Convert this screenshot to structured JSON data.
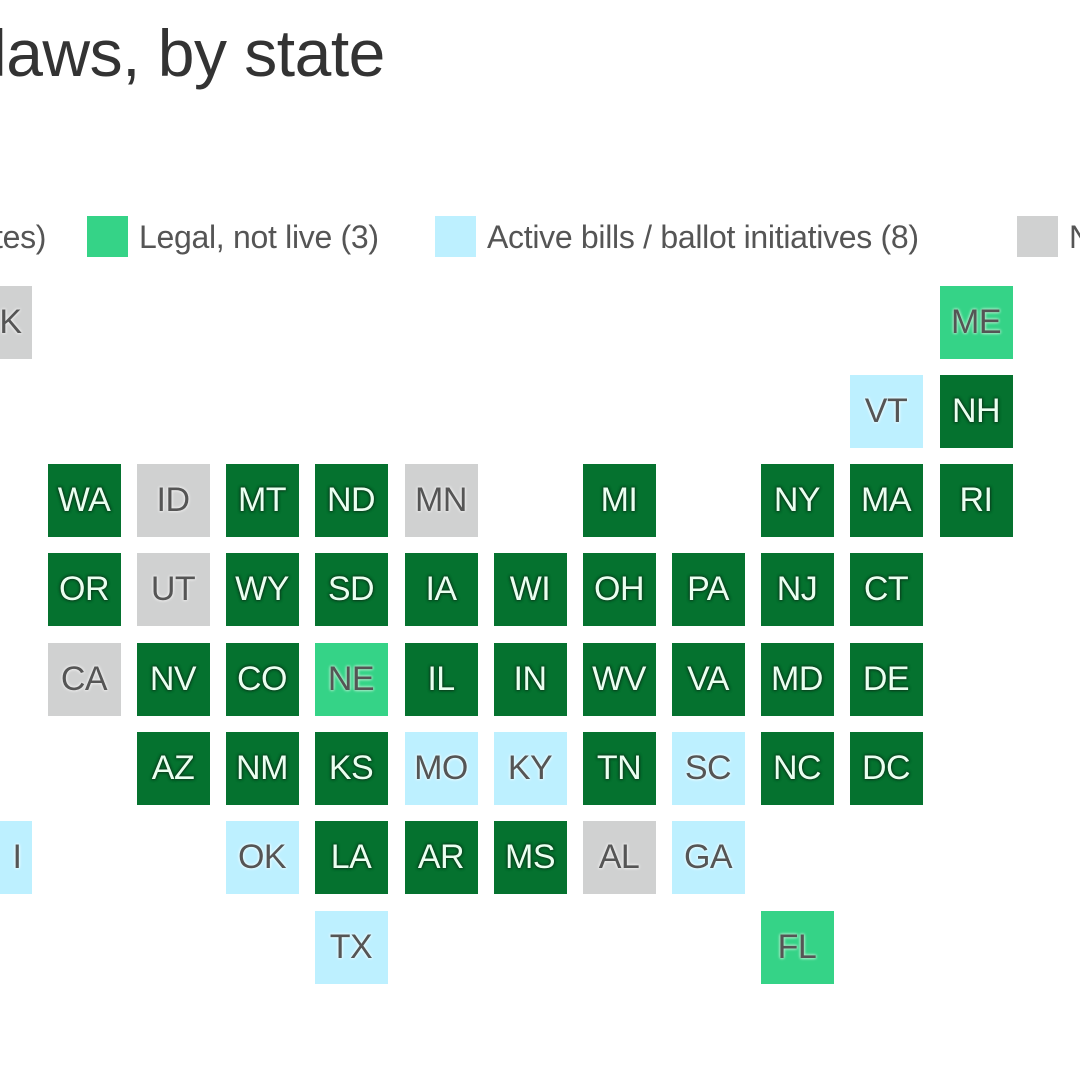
{
  "title": "g laws, by state",
  "legend": [
    {
      "key": "live",
      "label": "tes)",
      "color": "#05722f",
      "swatch": false
    },
    {
      "key": "notlive",
      "label": "Legal, not live (3)",
      "color": "#35d387",
      "swatch": true
    },
    {
      "key": "active",
      "label": "Active bills / ballot initiatives (8)",
      "color": "#bdf0ff",
      "swatch": true
    },
    {
      "key": "none",
      "label": "N",
      "color": "#d0d1d1",
      "swatch": true
    }
  ],
  "chart_data": {
    "type": "tile-map",
    "title": "g laws, by state",
    "categories": {
      "live": {
        "label": "(partially visible) ...tes)",
        "color": "#05722f"
      },
      "notlive": {
        "label": "Legal, not live (3)",
        "color": "#35d387"
      },
      "active": {
        "label": "Active bills/ballot initiatives (8)",
        "color": "#bdf0ff"
      },
      "none": {
        "label": "N... (cut off)",
        "color": "#d0d1d1"
      }
    },
    "states": [
      {
        "abbr": "AK",
        "label": "K",
        "status": "none",
        "col": 0,
        "row": 0
      },
      {
        "abbr": "ME",
        "label": "ME",
        "status": "notlive",
        "col": 11,
        "row": 0
      },
      {
        "abbr": "VT",
        "label": "VT",
        "status": "active",
        "col": 10,
        "row": 1
      },
      {
        "abbr": "NH",
        "label": "NH",
        "status": "live",
        "col": 11,
        "row": 1
      },
      {
        "abbr": "WA",
        "label": "WA",
        "status": "live",
        "col": 1,
        "row": 2
      },
      {
        "abbr": "ID",
        "label": "ID",
        "status": "none",
        "col": 2,
        "row": 2
      },
      {
        "abbr": "MT",
        "label": "MT",
        "status": "live",
        "col": 3,
        "row": 2
      },
      {
        "abbr": "ND",
        "label": "ND",
        "status": "live",
        "col": 4,
        "row": 2
      },
      {
        "abbr": "MN",
        "label": "MN",
        "status": "none",
        "col": 5,
        "row": 2
      },
      {
        "abbr": "MI",
        "label": "MI",
        "status": "live",
        "col": 7,
        "row": 2
      },
      {
        "abbr": "NY",
        "label": "NY",
        "status": "live",
        "col": 9,
        "row": 2
      },
      {
        "abbr": "MA",
        "label": "MA",
        "status": "live",
        "col": 10,
        "row": 2
      },
      {
        "abbr": "RI",
        "label": "RI",
        "status": "live",
        "col": 11,
        "row": 2
      },
      {
        "abbr": "OR",
        "label": "OR",
        "status": "live",
        "col": 1,
        "row": 3
      },
      {
        "abbr": "UT",
        "label": "UT",
        "status": "none",
        "col": 2,
        "row": 3
      },
      {
        "abbr": "WY",
        "label": "WY",
        "status": "live",
        "col": 3,
        "row": 3
      },
      {
        "abbr": "SD",
        "label": "SD",
        "status": "live",
        "col": 4,
        "row": 3
      },
      {
        "abbr": "IA",
        "label": "IA",
        "status": "live",
        "col": 5,
        "row": 3
      },
      {
        "abbr": "WI",
        "label": "WI",
        "status": "live",
        "col": 6,
        "row": 3
      },
      {
        "abbr": "OH",
        "label": "OH",
        "status": "live",
        "col": 7,
        "row": 3
      },
      {
        "abbr": "PA",
        "label": "PA",
        "status": "live",
        "col": 8,
        "row": 3
      },
      {
        "abbr": "NJ",
        "label": "NJ",
        "status": "live",
        "col": 9,
        "row": 3
      },
      {
        "abbr": "CT",
        "label": "CT",
        "status": "live",
        "col": 10,
        "row": 3
      },
      {
        "abbr": "CA",
        "label": "CA",
        "status": "none",
        "col": 1,
        "row": 4
      },
      {
        "abbr": "NV",
        "label": "NV",
        "status": "live",
        "col": 2,
        "row": 4
      },
      {
        "abbr": "CO",
        "label": "CO",
        "status": "live",
        "col": 3,
        "row": 4
      },
      {
        "abbr": "NE",
        "label": "NE",
        "status": "notlive",
        "col": 4,
        "row": 4
      },
      {
        "abbr": "IL",
        "label": "IL",
        "status": "live",
        "col": 5,
        "row": 4
      },
      {
        "abbr": "IN",
        "label": "IN",
        "status": "live",
        "col": 6,
        "row": 4
      },
      {
        "abbr": "WV",
        "label": "WV",
        "status": "live",
        "col": 7,
        "row": 4
      },
      {
        "abbr": "VA",
        "label": "VA",
        "status": "live",
        "col": 8,
        "row": 4
      },
      {
        "abbr": "MD",
        "label": "MD",
        "status": "live",
        "col": 9,
        "row": 4
      },
      {
        "abbr": "DE",
        "label": "DE",
        "status": "live",
        "col": 10,
        "row": 4
      },
      {
        "abbr": "AZ",
        "label": "AZ",
        "status": "live",
        "col": 2,
        "row": 5
      },
      {
        "abbr": "NM",
        "label": "NM",
        "status": "live",
        "col": 3,
        "row": 5
      },
      {
        "abbr": "KS",
        "label": "KS",
        "status": "live",
        "col": 4,
        "row": 5
      },
      {
        "abbr": "MO",
        "label": "MO",
        "status": "active",
        "col": 5,
        "row": 5
      },
      {
        "abbr": "KY",
        "label": "KY",
        "status": "active",
        "col": 6,
        "row": 5
      },
      {
        "abbr": "TN",
        "label": "TN",
        "status": "live",
        "col": 7,
        "row": 5
      },
      {
        "abbr": "SC",
        "label": "SC",
        "status": "active",
        "col": 8,
        "row": 5
      },
      {
        "abbr": "NC",
        "label": "NC",
        "status": "live",
        "col": 9,
        "row": 5
      },
      {
        "abbr": "DC",
        "label": "DC",
        "status": "live",
        "col": 10,
        "row": 5
      },
      {
        "abbr": "HI",
        "label": "I",
        "status": "active",
        "col": 0,
        "row": 6
      },
      {
        "abbr": "OK",
        "label": "OK",
        "status": "active",
        "col": 3,
        "row": 6
      },
      {
        "abbr": "LA",
        "label": "LA",
        "status": "live",
        "col": 4,
        "row": 6
      },
      {
        "abbr": "AR",
        "label": "AR",
        "status": "live",
        "col": 5,
        "row": 6
      },
      {
        "abbr": "MS",
        "label": "MS",
        "status": "live",
        "col": 6,
        "row": 6
      },
      {
        "abbr": "AL",
        "label": "AL",
        "status": "none",
        "col": 7,
        "row": 6
      },
      {
        "abbr": "GA",
        "label": "GA",
        "status": "active",
        "col": 8,
        "row": 6
      },
      {
        "abbr": "TX",
        "label": "TX",
        "status": "active",
        "col": 4,
        "row": 7
      },
      {
        "abbr": "FL",
        "label": "FL",
        "status": "notlive",
        "col": 9,
        "row": 7
      }
    ]
  }
}
